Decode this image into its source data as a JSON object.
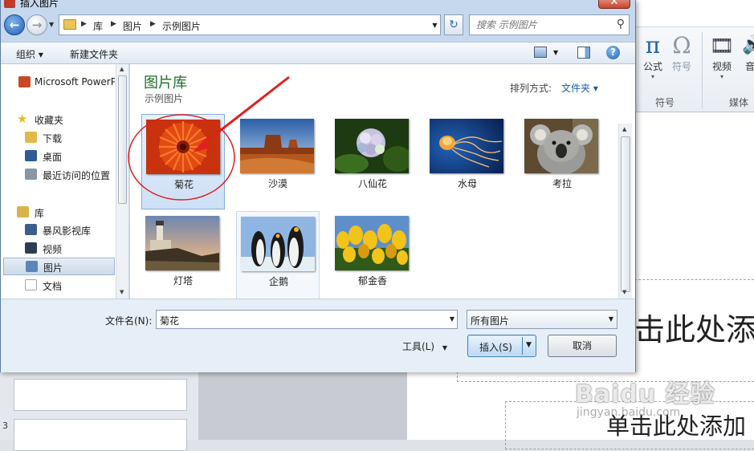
{
  "dialog": {
    "title": "插入图片",
    "close_label": "✕",
    "breadcrumb": [
      "库",
      "图片",
      "示例图片"
    ],
    "search_placeholder": "搜索 示例图片",
    "toolbar": {
      "organize": "组织 ▾",
      "new_folder": "新建文件夹"
    },
    "nav": [
      {
        "label": "Microsoft PowerPoint",
        "icon": "powerpoint-icon",
        "color": "#c84a24"
      },
      {
        "label": "收藏夹",
        "icon": "star-icon",
        "color": "#e9b821"
      },
      {
        "label": "下载",
        "icon": "download-folder-icon",
        "color": "#e2b94b"
      },
      {
        "label": "桌面",
        "icon": "desktop-icon",
        "color": "#2e5a98"
      },
      {
        "label": "最近访问的位置",
        "icon": "recent-places-icon",
        "color": "#8a96a4"
      },
      {
        "label": "库",
        "icon": "library-icon",
        "color": "#d9b34a"
      },
      {
        "label": "暴风影视库",
        "icon": "video-library-icon",
        "color": "#3b5f8d"
      },
      {
        "label": "视频",
        "icon": "video-icon",
        "color": "#2b3d55"
      },
      {
        "label": "图片",
        "icon": "pictures-icon",
        "color": "#5c86b9"
      },
      {
        "label": "文档",
        "icon": "documents-icon",
        "color": "#9aa7b6"
      }
    ],
    "library_title": "图片库",
    "library_subtitle": "示例图片",
    "sort_label": "排列方式:",
    "sort_value": "文件夹 ▾",
    "thumbnails": [
      {
        "label": "菊花",
        "icon": "chrysanthemum-image"
      },
      {
        "label": "沙漠",
        "icon": "desert-image"
      },
      {
        "label": "八仙花",
        "icon": "hydrangeas-image"
      },
      {
        "label": "水母",
        "icon": "jellyfish-image"
      },
      {
        "label": "考拉",
        "icon": "koala-image"
      },
      {
        "label": "灯塔",
        "icon": "lighthouse-image"
      },
      {
        "label": "企鹅",
        "icon": "penguins-image"
      },
      {
        "label": "郁金香",
        "icon": "tulips-image"
      }
    ],
    "filename_label": "文件名(N):",
    "filename_value": "菊花",
    "filetype_value": "所有图片",
    "tools_label": "工具(L)",
    "insert_label": "插入(S)",
    "cancel_label": "取消"
  },
  "ppt": {
    "ribbon_buttons": [
      {
        "glyph": "π",
        "label": "公式"
      },
      {
        "glyph": "Ω",
        "label": "符号"
      },
      {
        "glyph": "🎞",
        "label": "视频"
      },
      {
        "glyph": "🔊",
        "label": "音"
      }
    ],
    "ribbon_group_symbol": "符号",
    "ribbon_group_media": "媒体",
    "slide_number": "3",
    "title_placeholder": "击此处添",
    "subtitle_placeholder": "单击此处添加",
    "watermark": "Baidu 经验",
    "watermark_url": "jingyan.baidu.com"
  }
}
